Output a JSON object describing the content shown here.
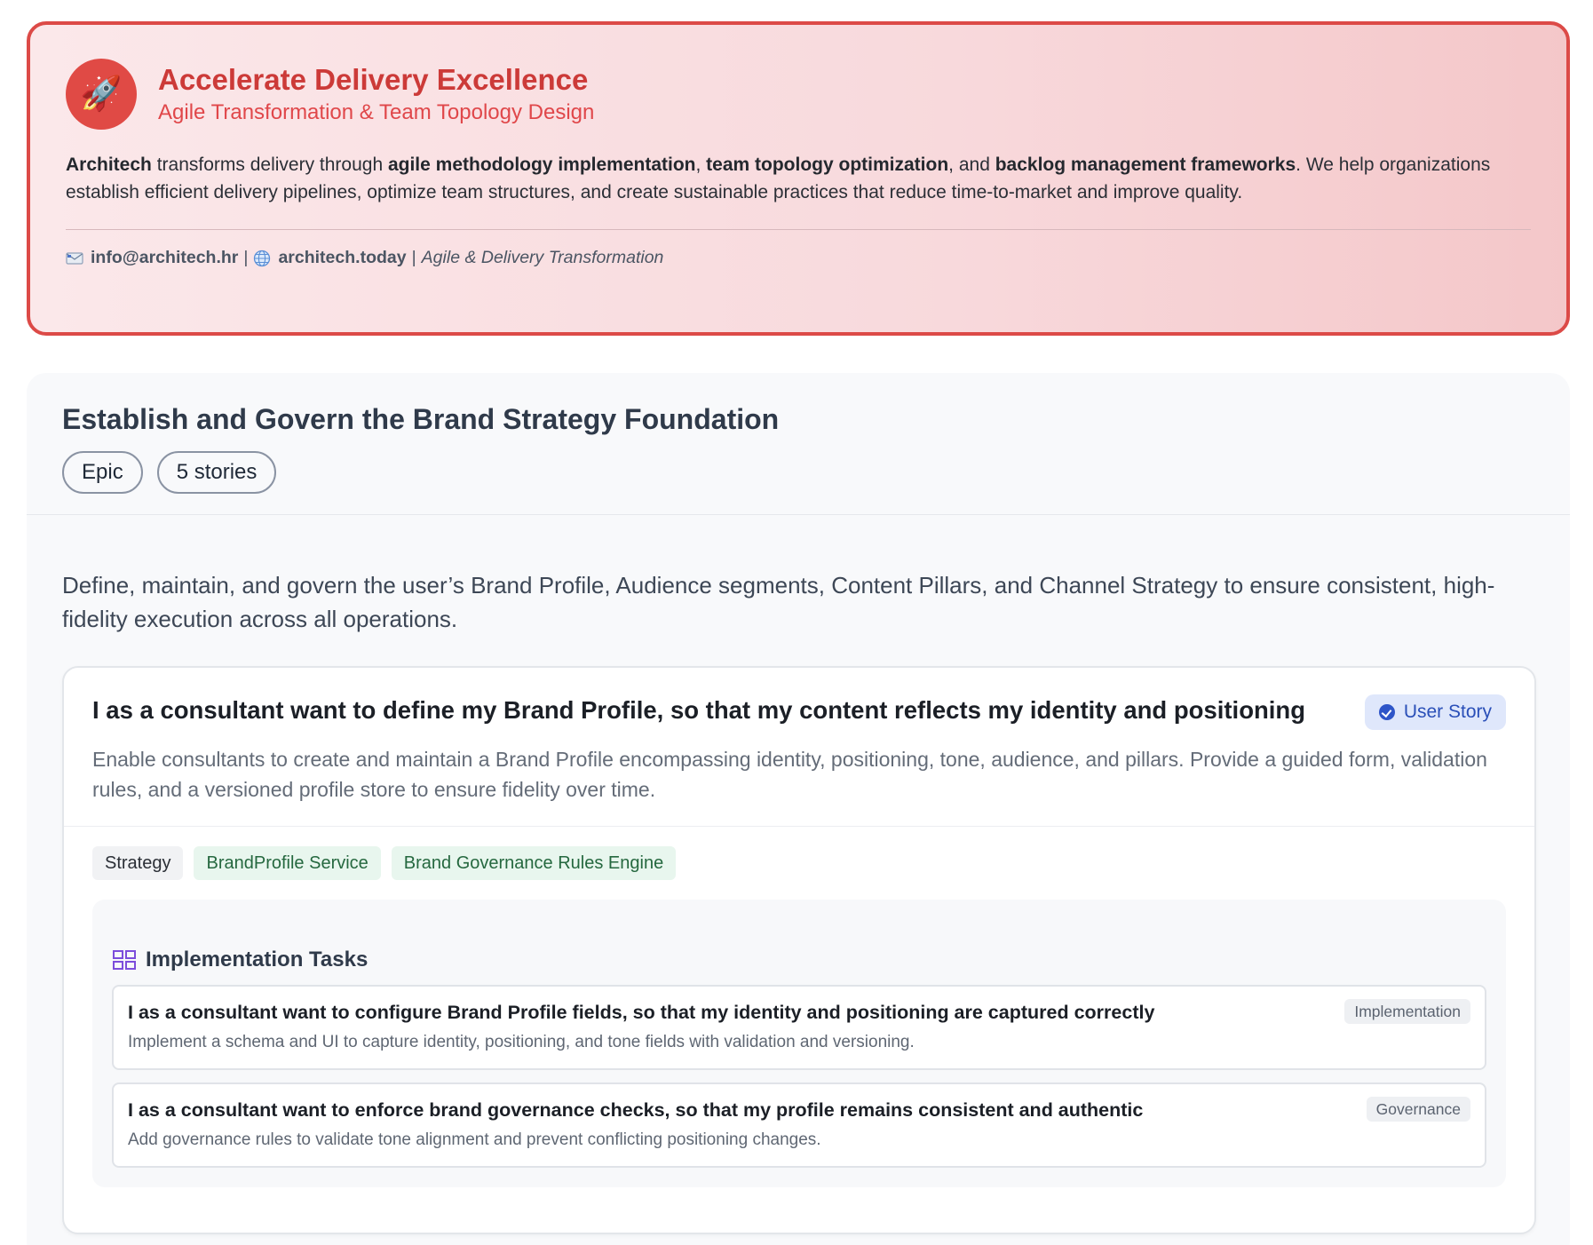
{
  "hero": {
    "logo_icon": "rocket-icon",
    "logo_glyph": "🚀",
    "title": "Accelerate Delivery Excellence",
    "subtitle": "Agile Transformation & Team Topology Design",
    "desc": {
      "company": "Architech",
      "t1": " transforms delivery through ",
      "b1": "agile methodology implementation",
      "t2": ", ",
      "b2": "team topology optimization",
      "t3": ", and ",
      "b3": "backlog management frameworks",
      "t4": ". We help organizations establish efficient delivery pipelines, optimize team structures, and create sustainable practices that reduce time-to-market and improve quality."
    },
    "contact": {
      "email": "info@architech.hr",
      "separator": "|",
      "website": "architech.today",
      "tagline": "Agile & Delivery Transformation"
    },
    "colors": {
      "border": "#dc4a47",
      "title": "#cc3a38",
      "accent": "#e04a45"
    }
  },
  "epic": {
    "title": "Establish and Govern the Brand Strategy Foundation",
    "type_badge": "Epic",
    "count_badge": "5 stories",
    "description": "Define, maintain, and govern the user’s Brand Profile, Audience segments, Content Pillars, and Channel Strategy to ensure consistent, high-fidelity execution across all operations.",
    "story": {
      "title": "I as a consultant want to define my Brand Profile, so that my content reflects my identity and positioning",
      "badge": "User Story",
      "description": "Enable consultants to create and maintain a Brand Profile encompassing identity, positioning, tone, audience, and pillars. Provide a guided form, validation rules, and a versioned profile store to ensure fidelity over time.",
      "tags": [
        {
          "label": "Strategy",
          "kind": "neutral"
        },
        {
          "label": "BrandProfile Service",
          "kind": "green"
        },
        {
          "label": "Brand Governance Rules Engine",
          "kind": "green"
        }
      ],
      "tasks_heading": "Implementation Tasks",
      "tasks": [
        {
          "title": "I as a consultant want to configure Brand Profile fields, so that my identity and positioning are captured correctly",
          "tag": "Implementation",
          "description": "Implement a schema and UI to capture identity, positioning, and tone fields with validation and versioning."
        },
        {
          "title": "I as a consultant want to enforce brand governance checks, so that my profile remains consistent and authentic",
          "tag": "Governance",
          "description": "Add governance rules to validate tone alignment and prevent conflicting positioning changes."
        }
      ]
    }
  }
}
